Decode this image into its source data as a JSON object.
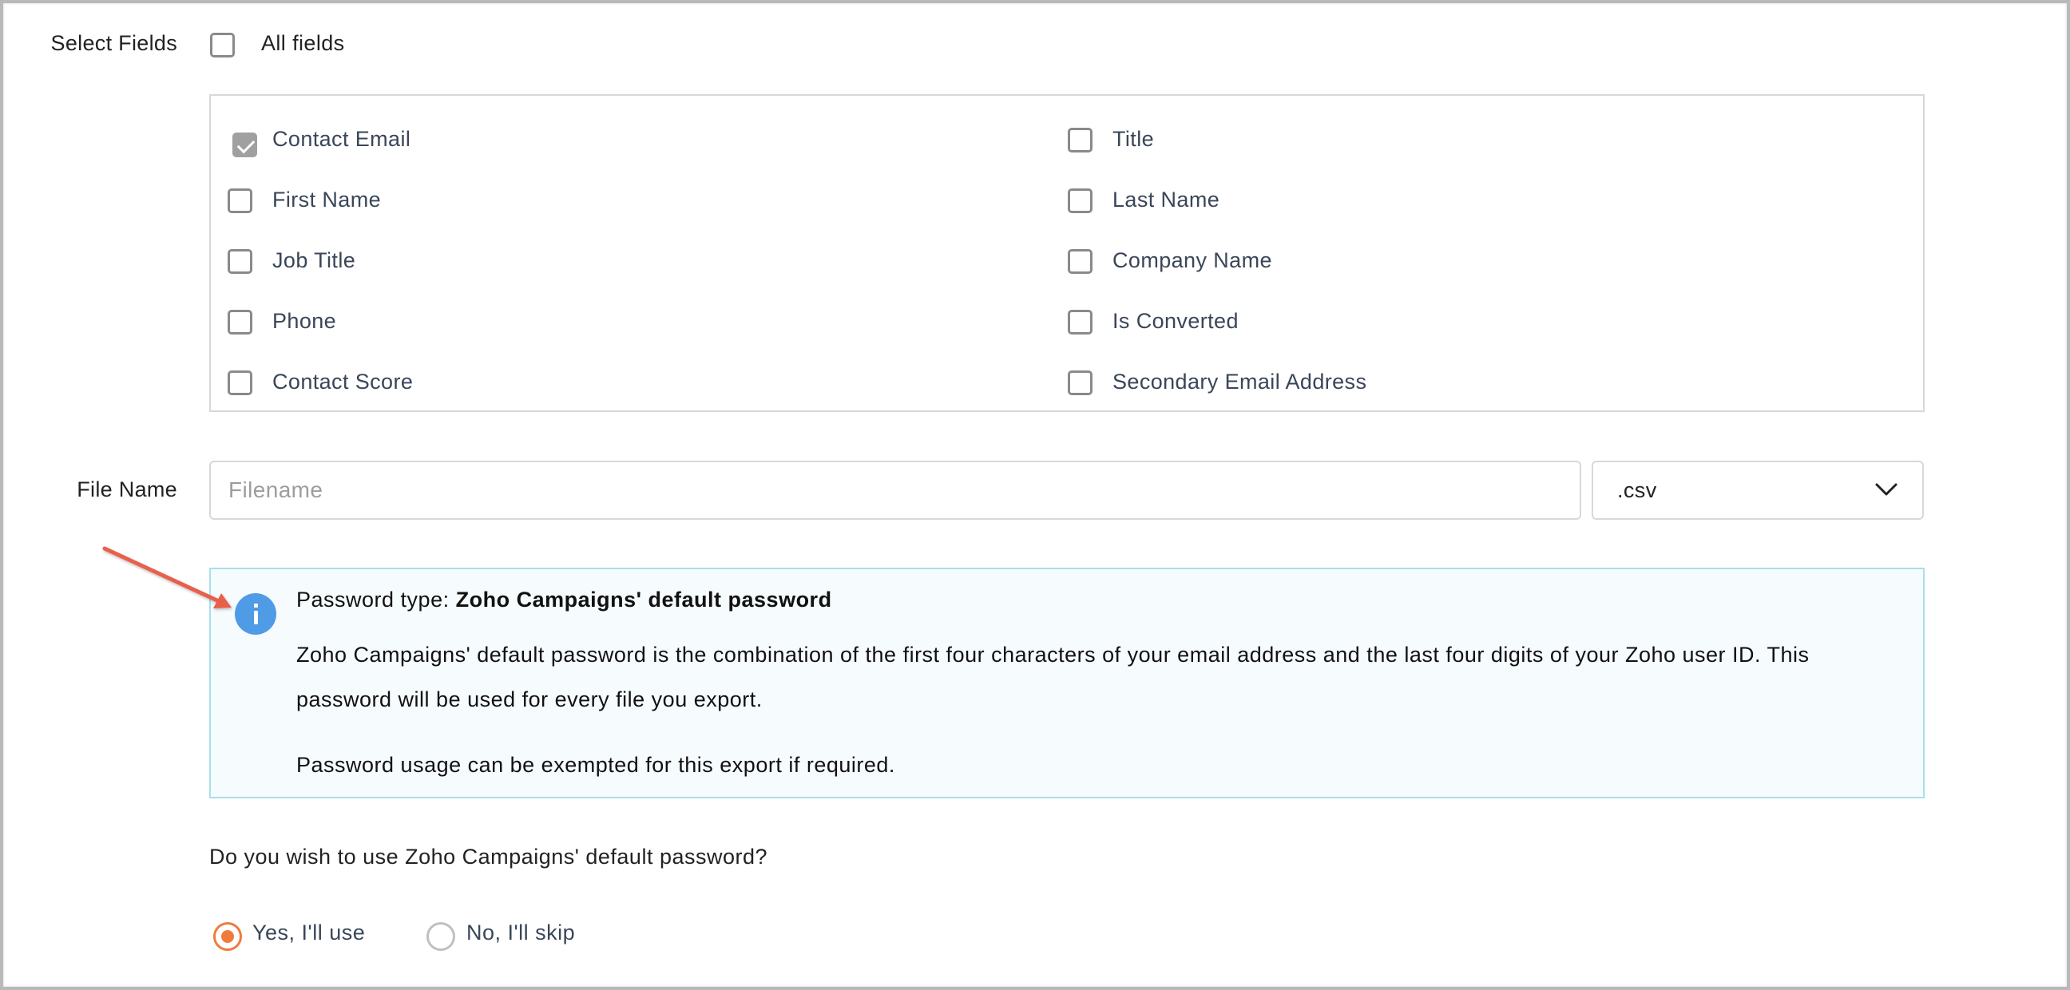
{
  "select_fields": {
    "label": "Select Fields",
    "all_fields": {
      "label": "All fields",
      "checked": false
    },
    "fields": [
      {
        "label": "Contact Email",
        "checked": true,
        "disabled": true
      },
      {
        "label": "Title",
        "checked": false
      },
      {
        "label": "First Name",
        "checked": false
      },
      {
        "label": "Last Name",
        "checked": false
      },
      {
        "label": "Job Title",
        "checked": false
      },
      {
        "label": "Company Name",
        "checked": false
      },
      {
        "label": "Phone",
        "checked": false
      },
      {
        "label": "Is Converted",
        "checked": false
      },
      {
        "label": "Contact Score",
        "checked": false
      },
      {
        "label": "Secondary Email Address",
        "checked": false
      }
    ]
  },
  "file_name": {
    "label": "File Name",
    "value": "",
    "placeholder": "Filename",
    "extension": {
      "selected": ".csv",
      "icon": "chevron-down-icon"
    }
  },
  "info": {
    "icon": "info-icon",
    "title_prefix": "Password type: ",
    "title_value": "Zoho Campaigns' default password",
    "paragraph1": "Zoho Campaigns' default password is the combination of the first four characters of your email address and the last four digits of your Zoho user ID. This password will be used for every file you export.",
    "paragraph2": "Password usage can be exempted for this export if required."
  },
  "password_choice": {
    "question": "Do you wish to use Zoho Campaigns' default password?",
    "options": [
      {
        "label": "Yes, I'll use",
        "selected": true
      },
      {
        "label": "No, I'll skip",
        "selected": false
      }
    ]
  },
  "annotation": {
    "type": "arrow",
    "color": "#e8604c"
  },
  "colors": {
    "accent_radio": "#f07b3b",
    "info_icon": "#4f9be6",
    "info_border": "#a9dfec",
    "info_background": "#f6fbfe"
  }
}
